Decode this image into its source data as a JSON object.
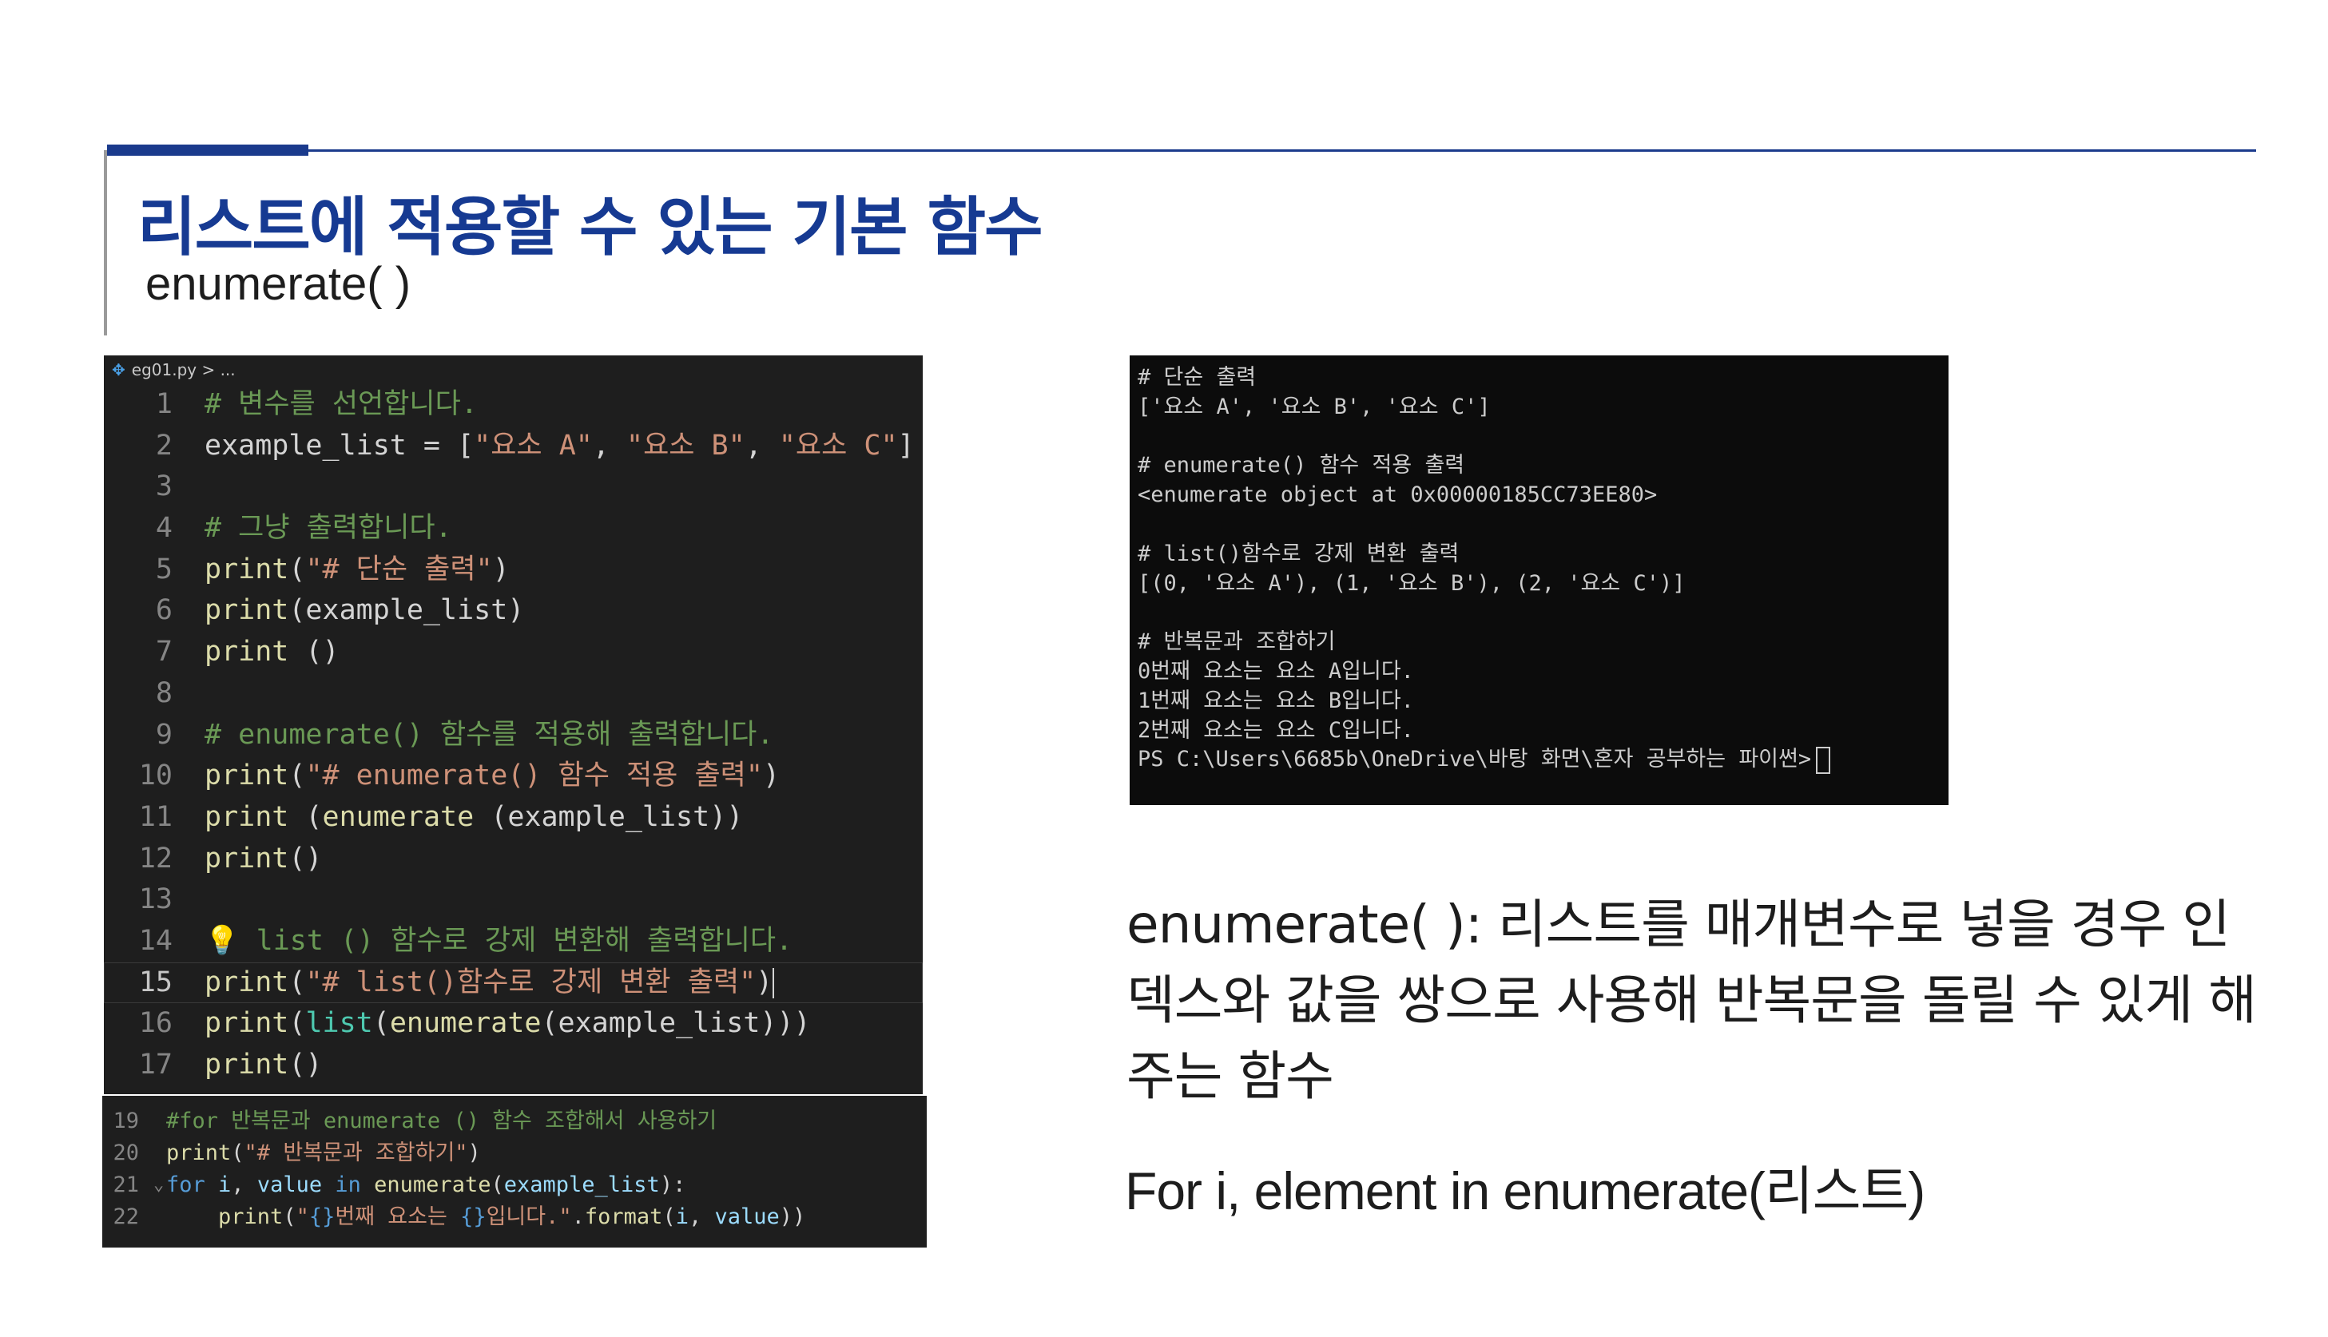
{
  "slide": {
    "title": "리스트에 적용할 수 있는 기본 함수",
    "subtitle": "enumerate( )",
    "accent_color": "#1a3a8c"
  },
  "editor": {
    "breadcrumb": "eg01.py > ...",
    "lines": [
      {
        "n": "1",
        "t": [
          [
            "# 변수를 선언합니다.",
            "c"
          ]
        ]
      },
      {
        "n": "2",
        "t": [
          [
            "example_list = [",
            "p"
          ],
          [
            "\"요소 A\"",
            "s"
          ],
          [
            ", ",
            "p"
          ],
          [
            "\"요소 B\"",
            "s"
          ],
          [
            ", ",
            "p"
          ],
          [
            "\"요소 C\"",
            "s"
          ],
          [
            "]",
            "p"
          ]
        ]
      },
      {
        "n": "3",
        "t": []
      },
      {
        "n": "4",
        "t": [
          [
            "# 그냥 출력합니다.",
            "c"
          ]
        ]
      },
      {
        "n": "5",
        "t": [
          [
            "print",
            "f"
          ],
          [
            "(",
            "p"
          ],
          [
            "\"# 단순 출력\"",
            "s"
          ],
          [
            ")",
            "p"
          ]
        ]
      },
      {
        "n": "6",
        "t": [
          [
            "print",
            "f"
          ],
          [
            "(example_list)",
            "p"
          ]
        ]
      },
      {
        "n": "7",
        "t": [
          [
            "print",
            "f"
          ],
          [
            " ()",
            "p"
          ]
        ]
      },
      {
        "n": "8",
        "t": []
      },
      {
        "n": "9",
        "t": [
          [
            "# enumerate() 함수를 적용해 출력합니다.",
            "c"
          ]
        ]
      },
      {
        "n": "10",
        "t": [
          [
            "print",
            "f"
          ],
          [
            "(",
            "p"
          ],
          [
            "\"# enumerate() 함수 적용 출력\"",
            "s"
          ],
          [
            ")",
            "p"
          ]
        ]
      },
      {
        "n": "11",
        "t": [
          [
            "print",
            "f"
          ],
          [
            " (",
            "p"
          ],
          [
            "enumerate",
            "f"
          ],
          [
            " (example_list))",
            "p"
          ]
        ]
      },
      {
        "n": "12",
        "t": [
          [
            "print",
            "f"
          ],
          [
            "()",
            "p"
          ]
        ]
      },
      {
        "n": "13",
        "t": []
      },
      {
        "n": "14",
        "t": [
          [
            "bulb",
            "bulb"
          ],
          [
            " list () 함수로 강제 변환해 출력합니다.",
            "c"
          ]
        ]
      },
      {
        "n": "15",
        "t": [
          [
            "print",
            "f"
          ],
          [
            "(",
            "p"
          ],
          [
            "\"# list()함수로 강제 변환 출력\"",
            "s"
          ],
          [
            ")",
            "p"
          ]
        ],
        "active": true
      },
      {
        "n": "16",
        "t": [
          [
            "print",
            "f"
          ],
          [
            "(",
            "p"
          ],
          [
            "list",
            "b"
          ],
          [
            "(",
            "p"
          ],
          [
            "enumerate",
            "f"
          ],
          [
            "(example_list)))",
            "p"
          ]
        ]
      },
      {
        "n": "17",
        "t": [
          [
            "print",
            "f"
          ],
          [
            "()",
            "p"
          ]
        ]
      }
    ]
  },
  "editor2": {
    "lines": [
      {
        "n": "19",
        "fold": "",
        "t": [
          [
            "#for 반복문과 enumerate () 함수 조합해서 사용하기",
            "c"
          ]
        ]
      },
      {
        "n": "20",
        "fold": "",
        "t": [
          [
            "print",
            "f"
          ],
          [
            "(",
            "p"
          ],
          [
            "\"# 반복문과 조합하기\"",
            "s"
          ],
          [
            ")",
            "p"
          ]
        ]
      },
      {
        "n": "21",
        "fold": "⌄",
        "t": [
          [
            "for",
            "k"
          ],
          [
            " ",
            "p"
          ],
          [
            "i",
            "v"
          ],
          [
            ", ",
            "p"
          ],
          [
            "value",
            "v"
          ],
          [
            " ",
            "p"
          ],
          [
            "in",
            "k"
          ],
          [
            " ",
            "p"
          ],
          [
            "enumerate",
            "f"
          ],
          [
            "(",
            "p"
          ],
          [
            "example_list",
            "v"
          ],
          [
            "):",
            "p"
          ]
        ]
      },
      {
        "n": "22",
        "fold": "",
        "t": [
          [
            "    ",
            "p"
          ],
          [
            "print",
            "f"
          ],
          [
            "(",
            "p"
          ],
          [
            "\"",
            "s"
          ],
          [
            "{}",
            "k"
          ],
          [
            "번째 요소는 ",
            "s"
          ],
          [
            "{}",
            "k"
          ],
          [
            "입니다.\"",
            "s"
          ],
          [
            ".",
            "p"
          ],
          [
            "format",
            "f"
          ],
          [
            "(",
            "p"
          ],
          [
            "i",
            "v"
          ],
          [
            ", ",
            "p"
          ],
          [
            "value",
            "v"
          ],
          [
            "))",
            "p"
          ]
        ]
      }
    ]
  },
  "terminal": {
    "lines": [
      "# 단순 출력",
      "['요소 A', '요소 B', '요소 C']",
      "",
      "# enumerate() 함수 적용 출력",
      "<enumerate object at 0x00000185CC73EE80>",
      "",
      "# list()함수로 강제 변환 출력",
      "[(0, '요소 A'), (1, '요소 B'), (2, '요소 C')]",
      "",
      "# 반복문과 조합하기",
      "0번째 요소는 요소 A입니다.",
      "1번째 요소는 요소 B입니다.",
      "2번째 요소는 요소 C입니다."
    ],
    "prompt": "PS C:\\Users\\6685b\\OneDrive\\바탕 화면\\혼자 공부하는 파이썬>"
  },
  "description": {
    "text": "enumerate( ): 리스트를 매개변수로 넣을 경우 인덱스와 값을 쌍으로 사용해 반복문을 돌릴 수 있게 해주는 함수",
    "syntax": "For i, element in enumerate(리스트)"
  }
}
